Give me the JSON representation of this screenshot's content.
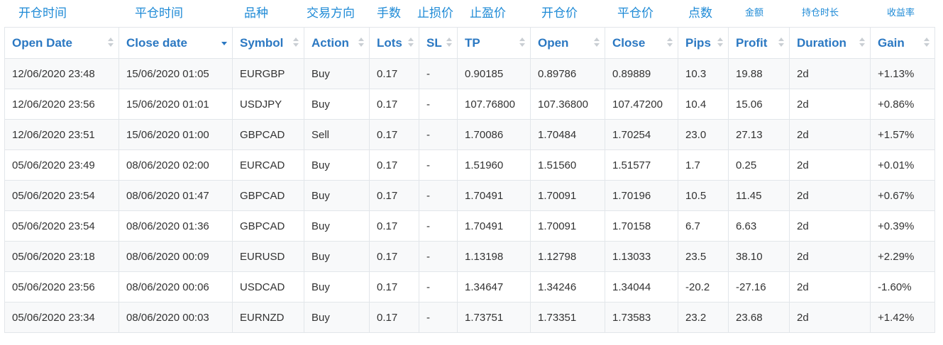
{
  "cn_headers": [
    "开仓时间",
    "平仓时间",
    "品种",
    "交易方向",
    "手数",
    "止损价",
    "止盈价",
    "开仓价",
    "平仓价",
    "点数",
    "金额",
    "持仓时长",
    "收益率"
  ],
  "columns": [
    "Open Date",
    "Close date",
    "Symbol",
    "Action",
    "Lots",
    "SL",
    "TP",
    "Open",
    "Close",
    "Pips",
    "Profit",
    "Duration",
    "Gain"
  ],
  "sorted_column": "Close date",
  "sort_direction": "descending",
  "colors": {
    "header": "#2b78c2",
    "chinese_header": "#1e8ad6",
    "positive": "#2aa33c",
    "negative": "#e33a3a"
  },
  "rows": [
    {
      "open_date": "12/06/2020 23:48",
      "close_date": "15/06/2020 01:05",
      "symbol": "EURGBP",
      "action": "Buy",
      "lots": "0.17",
      "sl": "-",
      "tp": "0.90185",
      "open": "0.89786",
      "close": "0.89889",
      "pips": "10.3",
      "profit": "19.88",
      "duration": "2d",
      "gain": "+1.13%"
    },
    {
      "open_date": "12/06/2020 23:56",
      "close_date": "15/06/2020 01:01",
      "symbol": "USDJPY",
      "action": "Buy",
      "lots": "0.17",
      "sl": "-",
      "tp": "107.76800",
      "open": "107.36800",
      "close": "107.47200",
      "pips": "10.4",
      "profit": "15.06",
      "duration": "2d",
      "gain": "+0.86%"
    },
    {
      "open_date": "12/06/2020 23:51",
      "close_date": "15/06/2020 01:00",
      "symbol": "GBPCAD",
      "action": "Sell",
      "lots": "0.17",
      "sl": "-",
      "tp": "1.70086",
      "open": "1.70484",
      "close": "1.70254",
      "pips": "23.0",
      "profit": "27.13",
      "duration": "2d",
      "gain": "+1.57%"
    },
    {
      "open_date": "05/06/2020 23:49",
      "close_date": "08/06/2020 02:00",
      "symbol": "EURCAD",
      "action": "Buy",
      "lots": "0.17",
      "sl": "-",
      "tp": "1.51960",
      "open": "1.51560",
      "close": "1.51577",
      "pips": "1.7",
      "profit": "0.25",
      "duration": "2d",
      "gain": "+0.01%"
    },
    {
      "open_date": "05/06/2020 23:54",
      "close_date": "08/06/2020 01:47",
      "symbol": "GBPCAD",
      "action": "Buy",
      "lots": "0.17",
      "sl": "-",
      "tp": "1.70491",
      "open": "1.70091",
      "close": "1.70196",
      "pips": "10.5",
      "profit": "11.45",
      "duration": "2d",
      "gain": "+0.67%"
    },
    {
      "open_date": "05/06/2020 23:54",
      "close_date": "08/06/2020 01:36",
      "symbol": "GBPCAD",
      "action": "Buy",
      "lots": "0.17",
      "sl": "-",
      "tp": "1.70491",
      "open": "1.70091",
      "close": "1.70158",
      "pips": "6.7",
      "profit": "6.63",
      "duration": "2d",
      "gain": "+0.39%"
    },
    {
      "open_date": "05/06/2020 23:18",
      "close_date": "08/06/2020 00:09",
      "symbol": "EURUSD",
      "action": "Buy",
      "lots": "0.17",
      "sl": "-",
      "tp": "1.13198",
      "open": "1.12798",
      "close": "1.13033",
      "pips": "23.5",
      "profit": "38.10",
      "duration": "2d",
      "gain": "+2.29%"
    },
    {
      "open_date": "05/06/2020 23:56",
      "close_date": "08/06/2020 00:06",
      "symbol": "USDCAD",
      "action": "Buy",
      "lots": "0.17",
      "sl": "-",
      "tp": "1.34647",
      "open": "1.34246",
      "close": "1.34044",
      "pips": "-20.2",
      "profit": "-27.16",
      "duration": "2d",
      "gain": "-1.60%"
    },
    {
      "open_date": "05/06/2020 23:34",
      "close_date": "08/06/2020 00:03",
      "symbol": "EURNZD",
      "action": "Buy",
      "lots": "0.17",
      "sl": "-",
      "tp": "1.73751",
      "open": "1.73351",
      "close": "1.73583",
      "pips": "23.2",
      "profit": "23.68",
      "duration": "2d",
      "gain": "+1.42%"
    }
  ]
}
